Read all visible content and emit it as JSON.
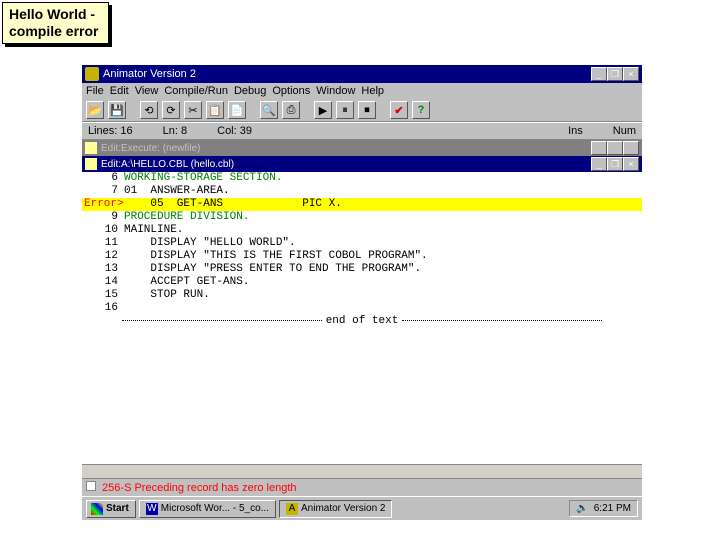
{
  "callout": {
    "line1": "Hello World -",
    "line2": "compile error"
  },
  "app": {
    "title": "Animator Version 2",
    "menu": [
      "File",
      "Edit",
      "View",
      "Compile/Run",
      "Debug",
      "Options",
      "Window",
      "Help"
    ],
    "winctrls": {
      "min": "_",
      "max": "❐",
      "close": "×"
    },
    "toolbar_icons": [
      "📂",
      "💾",
      "",
      "⟲",
      "⟳",
      "✂",
      "📋",
      "📄",
      "",
      "🔍",
      "⎙",
      "",
      "▶",
      "⏸",
      "⏹",
      "",
      "✔",
      "?"
    ],
    "status": {
      "lines": "Lines: 16",
      "ln": "Ln: 8",
      "col": "Col: 39",
      "ins": "Ins",
      "num": "Num"
    },
    "sub1": {
      "title": "Edit:Execute: (newfile)"
    },
    "sub2": {
      "title": "Edit:A:\\HELLO.CBL (hello.cbl)"
    },
    "code": [
      {
        "n": "6",
        "txt": "WORKING-STORAGE SECTION.",
        "cls": "kw-section"
      },
      {
        "n": "7",
        "txt": "01  ANSWER-AREA."
      },
      {
        "n": "8",
        "txt": "    05  GET-ANS            PIC X.",
        "hl": true,
        "err": "Error>"
      },
      {
        "n": "9",
        "txt": "PROCEDURE DIVISION.",
        "cls": "kw-div"
      },
      {
        "n": "10",
        "txt": "MAINLINE."
      },
      {
        "n": "11",
        "txt": "    DISPLAY \"HELLO WORLD\"."
      },
      {
        "n": "12",
        "txt": "    DISPLAY \"THIS IS THE FIRST COBOL PROGRAM\"."
      },
      {
        "n": "13",
        "txt": "    DISPLAY \"PRESS ENTER TO END THE PROGRAM\"."
      },
      {
        "n": "14",
        "txt": "    ACCEPT GET-ANS."
      },
      {
        "n": "15",
        "txt": "    STOP RUN."
      },
      {
        "n": "16",
        "txt": ""
      }
    ],
    "eot": "end of text",
    "error_msg": "256-S Preceding record has zero length"
  },
  "taskbar": {
    "start": "Start",
    "items": [
      {
        "label": "Microsoft Wor... - 5_co...",
        "icon": "W"
      },
      {
        "label": "Animator Version 2",
        "icon": "A",
        "active": true
      }
    ],
    "tray_icon": "🔊",
    "clock": "6:21 PM"
  }
}
